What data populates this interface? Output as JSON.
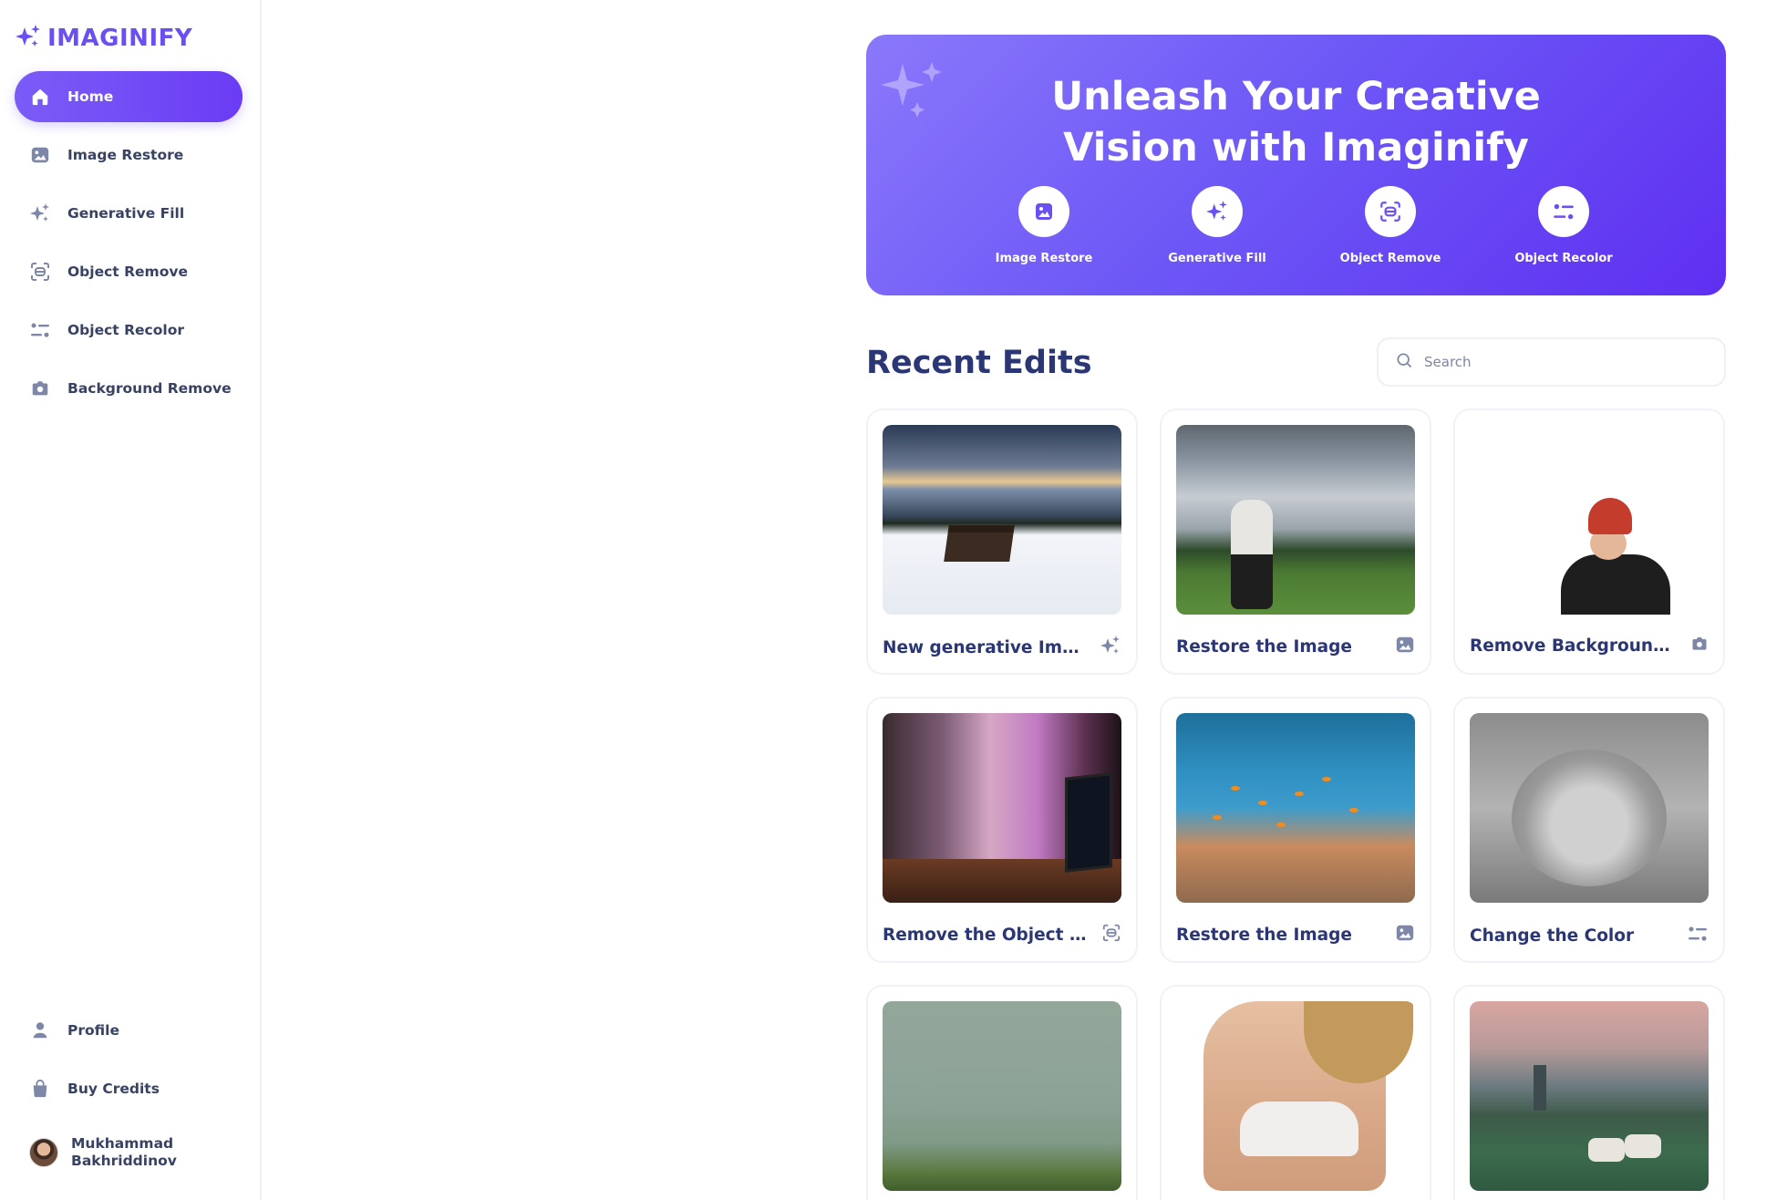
{
  "app": {
    "logo_text": "IMAGINIFY",
    "accent": "#6c4ff2"
  },
  "sidebar": {
    "items": [
      {
        "label": "Home",
        "icon": "home-icon",
        "active": true
      },
      {
        "label": "Image Restore",
        "icon": "image-icon"
      },
      {
        "label": "Generative Fill",
        "icon": "stars-icon"
      },
      {
        "label": "Object Remove",
        "icon": "scan-icon"
      },
      {
        "label": "Object Recolor",
        "icon": "filter-icon"
      },
      {
        "label": "Background Remove",
        "icon": "camera-icon"
      }
    ],
    "bottom": [
      {
        "label": "Profile",
        "icon": "user-icon"
      },
      {
        "label": "Buy Credits",
        "icon": "bag-icon"
      }
    ],
    "user": {
      "first_name": "Mukhammad",
      "last_name": "Bakhriddinov"
    }
  },
  "banner": {
    "title_line1": "Unleash Your Creative",
    "title_line2": "Vision with Imaginify",
    "tools": [
      {
        "label": "Image Restore",
        "icon": "image-icon"
      },
      {
        "label": "Generative Fill",
        "icon": "stars-icon"
      },
      {
        "label": "Object Remove",
        "icon": "scan-icon"
      },
      {
        "label": "Object Recolor",
        "icon": "filter-icon"
      }
    ]
  },
  "recent": {
    "title": "Recent Edits",
    "search_placeholder": "Search",
    "cards": [
      {
        "title": "New generative Image",
        "icon": "stars-icon"
      },
      {
        "title": "Restore the Image",
        "icon": "image-icon"
      },
      {
        "title": "Remove Background...",
        "icon": "camera-icon"
      },
      {
        "title": "Remove the Object fro...",
        "icon": "scan-icon"
      },
      {
        "title": "Restore the Image",
        "icon": "image-icon"
      },
      {
        "title": "Change the Color",
        "icon": "filter-icon"
      },
      {
        "title": "",
        "icon": ""
      },
      {
        "title": "",
        "icon": ""
      },
      {
        "title": "",
        "icon": ""
      }
    ]
  }
}
